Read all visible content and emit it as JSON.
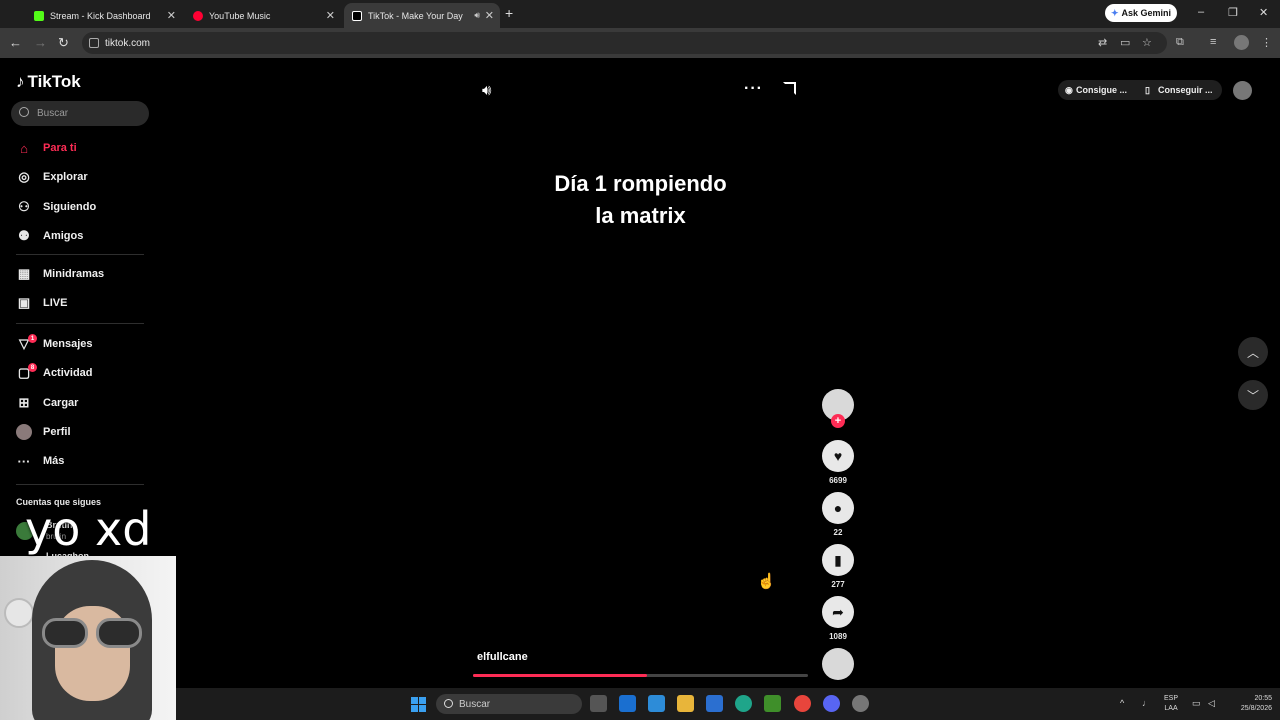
{
  "browser": {
    "tabs": [
      {
        "title": "Stream - Kick Dashboard",
        "color": "#53fc18"
      },
      {
        "title": "YouTube Music",
        "color": "#ff0033"
      },
      {
        "title": "TikTok - Make Your Day",
        "color": "#ffffff",
        "active": true,
        "playing_audio": true
      }
    ],
    "new_tab": "+",
    "ask_gemini": "Ask Gemini",
    "url": "tiktok.com",
    "window_controls": {
      "minimize": "–",
      "restore": "❐",
      "close": "✕"
    }
  },
  "sidebar": {
    "logo": "TikTok",
    "search_placeholder": "Buscar",
    "items": [
      {
        "label": "Para ti",
        "icon": "home-icon",
        "active": true
      },
      {
        "label": "Explorar",
        "icon": "compass-icon"
      },
      {
        "label": "Siguiendo",
        "icon": "following-icon"
      },
      {
        "label": "Amigos",
        "icon": "friends-icon"
      },
      {
        "label": "Minidramas",
        "icon": "film-icon"
      },
      {
        "label": "LIVE",
        "icon": "live-icon"
      },
      {
        "label": "Mensajes",
        "icon": "messages-icon",
        "badge": "1"
      },
      {
        "label": "Actividad",
        "icon": "activity-icon",
        "badge": "8"
      },
      {
        "label": "Cargar",
        "icon": "upload-icon"
      },
      {
        "label": "Perfil",
        "icon": "profile-avatar"
      },
      {
        "label": "Más",
        "icon": "more-icon"
      }
    ],
    "following_title": "Cuentas que sigues",
    "following": [
      {
        "name": "Brutin",
        "handle": "brutin"
      },
      {
        "name": "Lucaghon"
      }
    ]
  },
  "overlay_text": "yo xd",
  "video": {
    "title_line1": "Día 1 rompiendo",
    "title_line2": "la matrix",
    "author": "elfullcane",
    "progress": 0.52,
    "likes": "6699",
    "comments": "22",
    "saves": "277",
    "shares": "1089"
  },
  "topright": {
    "get_coins": "Consigue ...",
    "get_app": "Conseguir ..."
  },
  "taskbar": {
    "search_placeholder": "Buscar",
    "lang_line1": "ESP",
    "lang_line2": "LAA",
    "time": "20:55",
    "date": "25/8/2026"
  }
}
